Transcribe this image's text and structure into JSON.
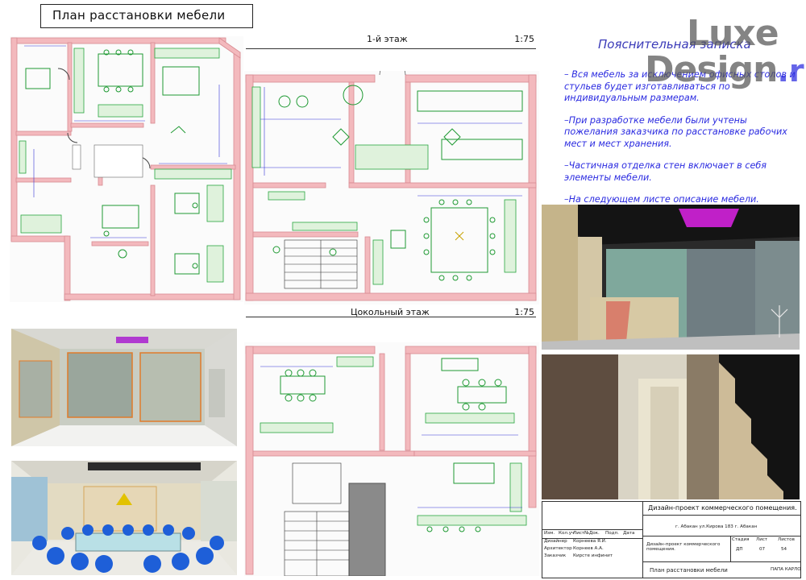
{
  "sheet_title": "План расстановки мебели",
  "floor1": {
    "label": "1-й этаж",
    "scale": "1:75"
  },
  "basement": {
    "label": "Цокольный этаж",
    "scale": "1:75"
  },
  "note": {
    "title": "Пояснительная записка",
    "paragraphs": [
      "– Вся мебель за исключением офисных столов и стульев будет изготавливаться по индивидуальным размерам.",
      "–При разработке мебели были учтены пожелания заказчика по расстановке рабочих мест и мест хранения.",
      "–Частичная  отделка стен включает в себя элементы мебели.",
      "–На следующем листе описание мебели."
    ]
  },
  "logo": {
    "line1": "Luxe",
    "line2": "Design",
    "suffix": ".ru"
  },
  "stamp": {
    "project_title": "Дизайн-проект коммерческого помещения.",
    "address": "г. Абакан ул.Кирова 183 г. Абакан",
    "header_cols": [
      "Изм.",
      "Кол.уч",
      "Лист",
      "№Док.",
      "Подп.",
      "Дата"
    ],
    "roles": [
      {
        "role": "Дизайнер",
        "name": "Корнеева Я.И."
      },
      {
        "role": "Архитектор",
        "name": "Корнеев А.А."
      },
      {
        "role": "Заказчик",
        "name": "Кирсте инфинит"
      }
    ],
    "doc_name": "Дизайн-проект коммерческого помещения.",
    "stage_label": "Стадия",
    "sheet_label": "Лист",
    "sheets_label": "Листов",
    "stage": "ДП",
    "sheet": "07",
    "sheets": "54",
    "drawing_name": "План расстановки мебели",
    "org": "ПАПА КАРЛО"
  },
  "colors": {
    "wall": "#f3b9bd",
    "furniture": "#22aa33",
    "dim": "#3535d8",
    "note": "#2a2ae0"
  }
}
